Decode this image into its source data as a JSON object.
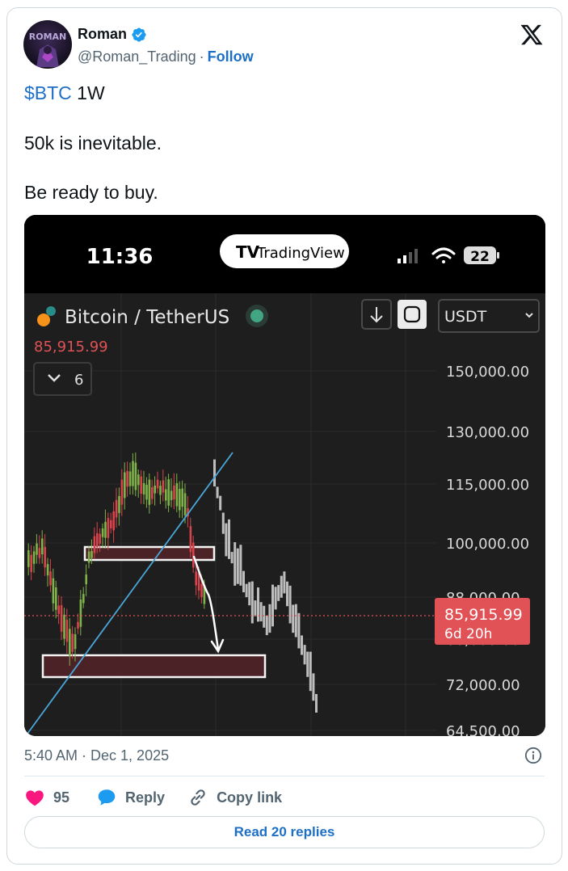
{
  "author": {
    "name": "Roman",
    "handle": "@Roman_Trading",
    "separator": "·",
    "follow_label": "Follow",
    "avatar_text": "ROMAN"
  },
  "tweet": {
    "line1_cashtag": "$BTC",
    "line1_rest": " 1W",
    "line2": "50k is inevitable.",
    "line3": "Be ready to buy."
  },
  "media": {
    "status_time": "11:36",
    "app_badge": "TradingView",
    "battery": "22",
    "symbol_title": "Bitcoin / TetherUS",
    "last_price": "85,915.99",
    "indicators_count": "6",
    "currency_select": "USDT",
    "price_label": "85,915.99",
    "countdown": "6d 20h",
    "y_ticks": [
      "150,000.00",
      "130,000.00",
      "115,000.00",
      "100,000.00",
      "88,000.00",
      "80,000.00",
      "72,000.00",
      "64,500.00"
    ],
    "colors": {
      "background": "#1e1e1e",
      "up": "#7fb34a",
      "down": "#d9434c",
      "projection": "#bdbdbd",
      "trendline": "#48a6d8",
      "zone": "#4b2226",
      "price_badge": "#e05256"
    }
  },
  "footer": {
    "timestamp": "5:40 AM · Dec 1, 2025",
    "likes": "95",
    "reply_label": "Reply",
    "copy_label": "Copy link",
    "read_replies": "Read 20 replies"
  },
  "colors": {
    "link": "#1d6fc6",
    "like": "#f91880",
    "muted": "#536471"
  }
}
